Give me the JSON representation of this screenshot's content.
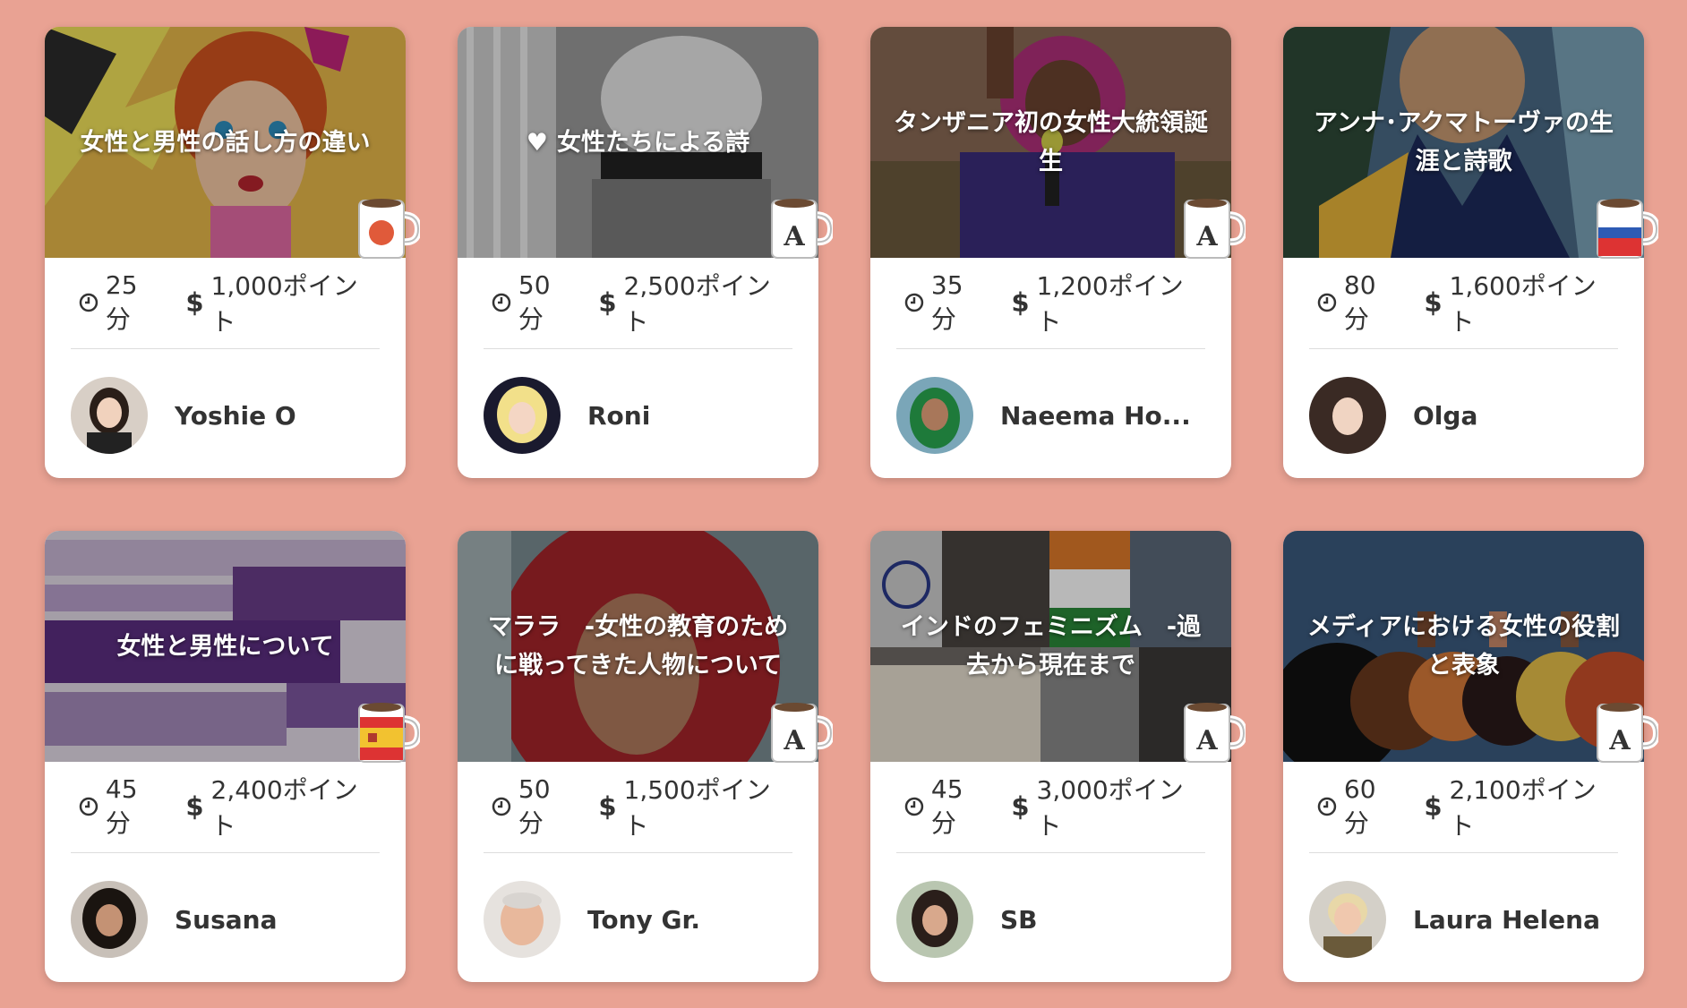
{
  "colors": {
    "background": "#e9a293",
    "card": "#ffffff",
    "text": "#333333"
  },
  "cards": [
    {
      "title": "女性と男性の話し方の違い",
      "duration": "25分",
      "points": "1,000ポイント",
      "teacher": "Yoshie O",
      "language_icon": "japan-flag-mug-icon"
    },
    {
      "title": "女性たちによる詩",
      "title_icon": "heart-icon",
      "duration": "50分",
      "points": "2,500ポイント",
      "teacher": "Roni",
      "language_icon": "english-a-mug-icon"
    },
    {
      "title": "タンザニア初の女性大統領誕生",
      "duration": "35分",
      "points": "1,200ポイント",
      "teacher": "Naeema Ho...",
      "language_icon": "english-a-mug-icon"
    },
    {
      "title": "アンナ･アクマトーヴァの生涯と詩歌",
      "duration": "80分",
      "points": "1,600ポイント",
      "teacher": "Olga",
      "language_icon": "russia-flag-mug-icon"
    },
    {
      "title": "女性と男性について",
      "duration": "45分",
      "points": "2,400ポイント",
      "teacher": "Susana",
      "language_icon": "spain-flag-mug-icon"
    },
    {
      "title": "マララ　-女性の教育のために戦ってきた人物について",
      "duration": "50分",
      "points": "1,500ポイント",
      "teacher": "Tony Gr.",
      "language_icon": "english-a-mug-icon"
    },
    {
      "title": "インドのフェミニズム　-過去から現在まで",
      "duration": "45分",
      "points": "3,000ポイント",
      "teacher": "SB",
      "language_icon": "english-a-mug-icon"
    },
    {
      "title": "メディアにおける女性の役割と表象",
      "duration": "60分",
      "points": "2,100ポイント",
      "teacher": "Laura Helena",
      "language_icon": "english-a-mug-icon"
    }
  ]
}
